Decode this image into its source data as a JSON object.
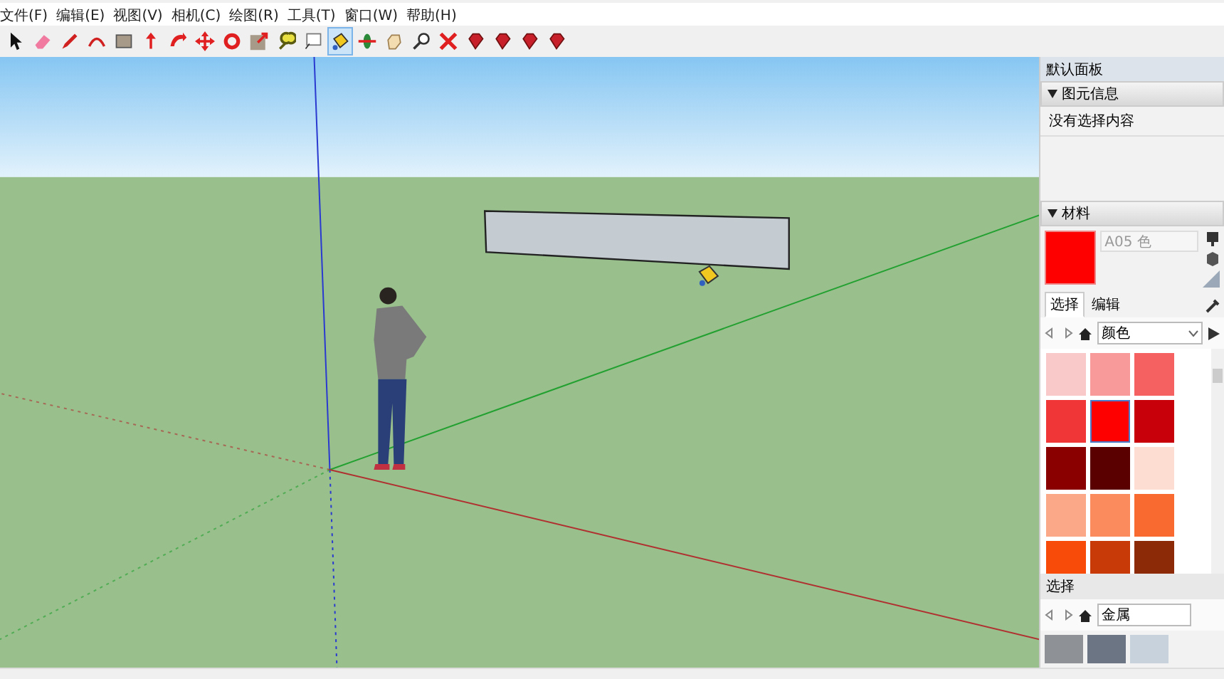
{
  "menu": [
    "文件(F)",
    "编辑(E)",
    "视图(V)",
    "相机(C)",
    "绘图(R)",
    "工具(T)",
    "窗口(W)",
    "帮助(H)"
  ],
  "toolbar": [
    {
      "kind": "select",
      "selected": false
    },
    {
      "kind": "eraser",
      "selected": false
    },
    {
      "kind": "pencil",
      "selected": false
    },
    {
      "kind": "arc",
      "selected": false
    },
    {
      "kind": "rect",
      "selected": false
    },
    {
      "kind": "push",
      "selected": false
    },
    {
      "kind": "follow",
      "selected": false
    },
    {
      "kind": "move",
      "selected": false
    },
    {
      "kind": "rotate",
      "selected": false
    },
    {
      "kind": "scale",
      "selected": false
    },
    {
      "kind": "tape",
      "selected": false
    },
    {
      "kind": "text",
      "selected": false
    },
    {
      "kind": "bucket",
      "selected": true
    },
    {
      "kind": "orbit",
      "selected": false
    },
    {
      "kind": "pan",
      "selected": false
    },
    {
      "kind": "zoom",
      "selected": false
    },
    {
      "kind": "extents",
      "selected": false
    },
    {
      "kind": "gem",
      "selected": false
    },
    {
      "kind": "gem",
      "selected": false
    },
    {
      "kind": "gem",
      "selected": false
    },
    {
      "kind": "gem",
      "selected": false
    }
  ],
  "panel": {
    "title": "默认面板",
    "entity_info": {
      "title": "图元信息",
      "text": "没有选择内容"
    },
    "materials": {
      "title": "材料",
      "name": "A05 色",
      "tabs": [
        {
          "label": "选择",
          "selected": true
        },
        {
          "label": "编辑",
          "selected": false
        }
      ],
      "library": "颜色",
      "swatches": [
        {
          "color": "#f9c8c8",
          "selected": false
        },
        {
          "color": "#f99a9a",
          "selected": false
        },
        {
          "color": "#f56060",
          "selected": false
        },
        {
          "color": "#f03636",
          "selected": false
        },
        {
          "color": "#ff0000",
          "selected": true
        },
        {
          "color": "#c8000a",
          "selected": false
        },
        {
          "color": "#8a0000",
          "selected": false
        },
        {
          "color": "#5a0000",
          "selected": false
        },
        {
          "color": "#fddcd2",
          "selected": false
        },
        {
          "color": "#fba888",
          "selected": false
        },
        {
          "color": "#fb8a5c",
          "selected": false
        },
        {
          "color": "#f86a30",
          "selected": false
        },
        {
          "color": "#f84a08",
          "selected": false
        },
        {
          "color": "#c83a08",
          "selected": false
        },
        {
          "color": "#8c2a08",
          "selected": false
        }
      ],
      "secondary": {
        "title": "选择",
        "library": "金属"
      }
    }
  }
}
